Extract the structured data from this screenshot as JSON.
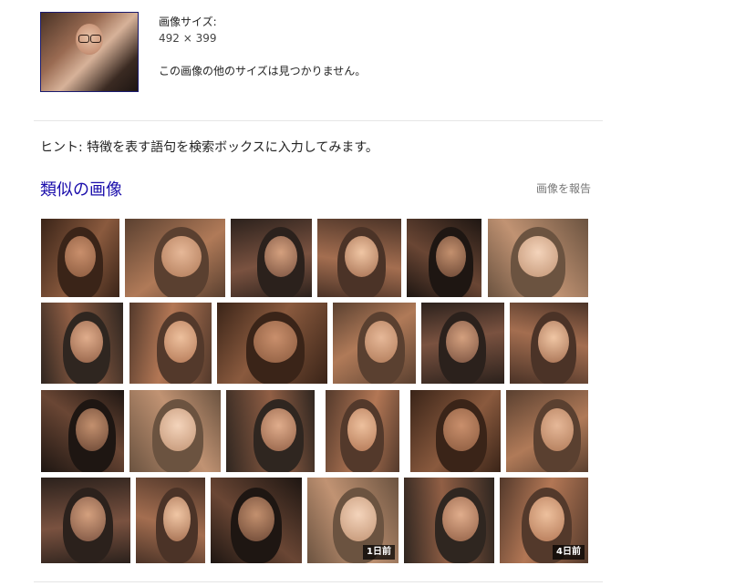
{
  "query": {
    "thumbnail_icon": "query-image-thumbnail"
  },
  "info": {
    "size_label": "画像サイズ:",
    "size_value": "492 × 399",
    "no_other_sizes": "この画像の他のサイズは見つかりません。"
  },
  "hint": "ヒント: 特徴を表す語句を検索ボックスに入力してみます。",
  "similar": {
    "title": "類似の画像",
    "report": "画像を報告",
    "badges": [
      "1日前",
      "4日前"
    ]
  },
  "colors": {
    "link": "#1a0dab",
    "divider": "#e5e5e5"
  }
}
